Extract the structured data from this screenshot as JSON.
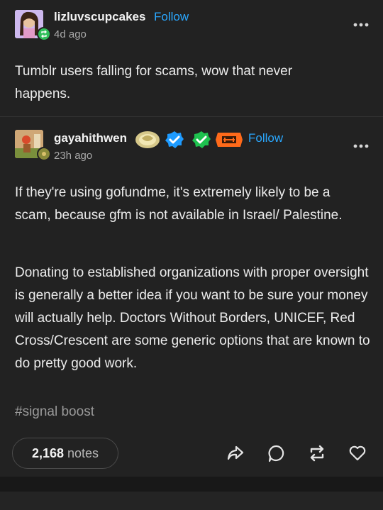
{
  "reblog": {
    "username": "lizluvscupcakes",
    "follow_label": "Follow",
    "time": "4d ago",
    "text": "Tumblr users falling for scams, wow that never happens."
  },
  "original": {
    "username": "gayahithwen",
    "follow_label": "Follow",
    "time": "23h ago",
    "paragraph1": "If they're using gofundme, it's extremely likely to be a scam, because gfm is not available in Israel/ Palestine.",
    "paragraph2": "Donating to established organizations with proper oversight is generally a better idea if you want to be sure your money will actually help. Doctors Without Borders, UNICEF, Red Cross/Crescent are some generic options that are known to do pretty good work.",
    "tag": "#signal boost"
  },
  "footer": {
    "notes_count": "2,168",
    "notes_label": "notes"
  },
  "colors": {
    "background": "#222222",
    "accent_blue": "#2aa8ff",
    "reblog_green": "#2fbf5a",
    "badge_orange": "#ff6a1a"
  }
}
